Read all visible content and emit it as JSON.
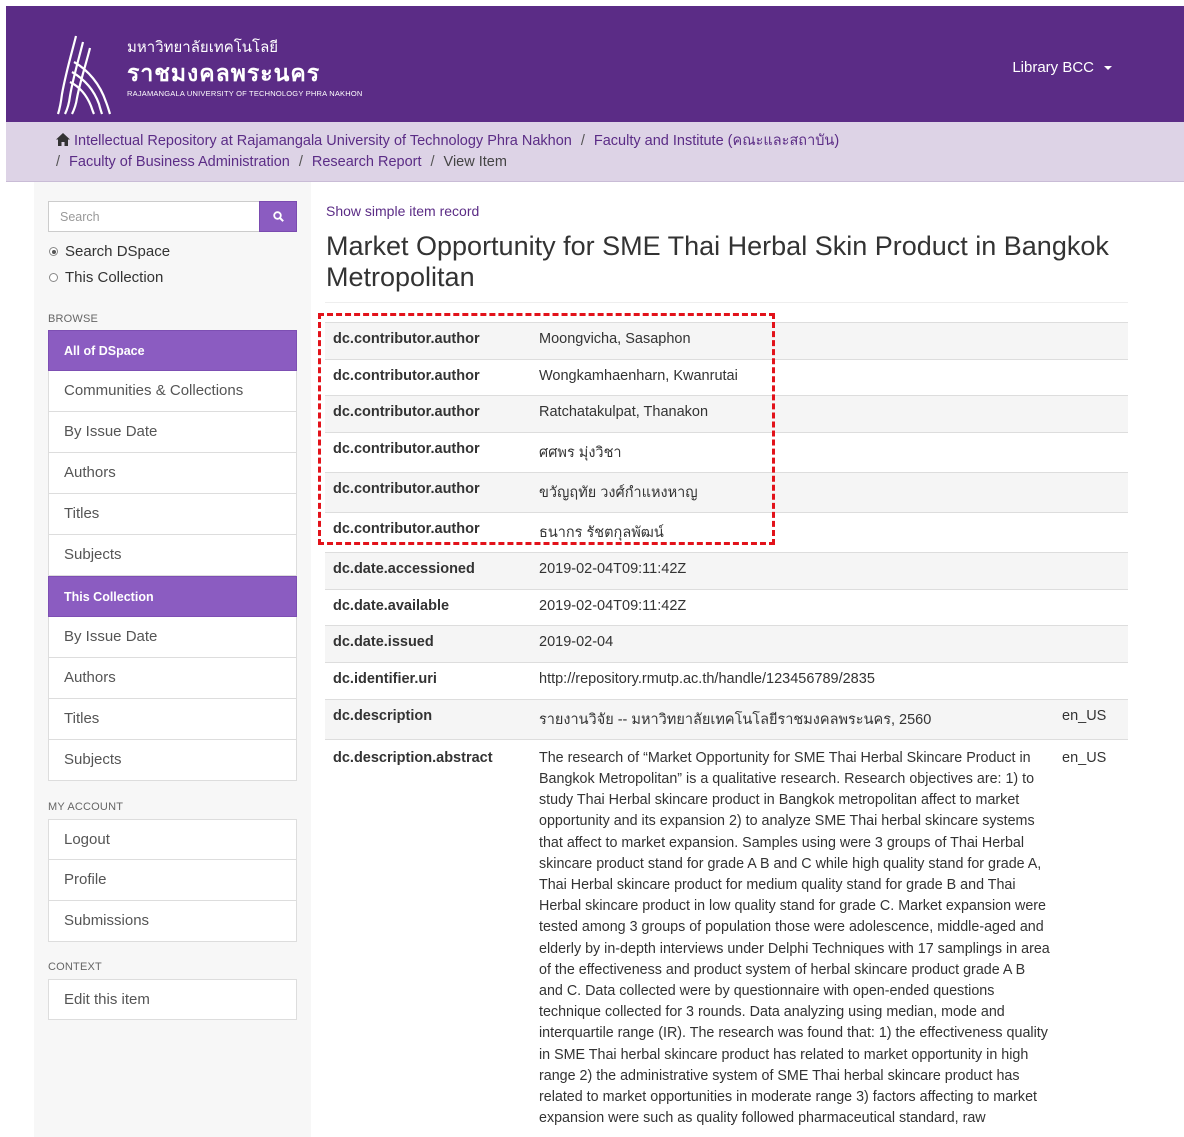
{
  "header": {
    "logo_line1": "มหาวิทยาลัยเทคโนโลยี",
    "logo_line2": "ราชมงคลพระนคร",
    "logo_line3": "RAJAMANGALA UNIVERSITY OF TECHNOLOGY PHRA NAKHON",
    "user_menu_label": "Library BCC"
  },
  "breadcrumb": {
    "items": [
      "Intellectual Repository at Rajamangala University of Technology Phra Nakhon",
      "Faculty and Institute (คณะและสถาบัน)",
      "Faculty of Business Administration",
      "Research Report"
    ],
    "current": "View Item",
    "separator": "/"
  },
  "sidebar": {
    "search_placeholder": "Search",
    "scope_options": [
      "Search DSpace",
      "This Collection"
    ],
    "browse_label": "BROWSE",
    "all_dspace_head": "All of DSpace",
    "all_dspace_items": [
      "Communities & Collections",
      "By Issue Date",
      "Authors",
      "Titles",
      "Subjects"
    ],
    "collection_head": "This Collection",
    "collection_items": [
      "By Issue Date",
      "Authors",
      "Titles",
      "Subjects"
    ],
    "account_label": "MY ACCOUNT",
    "account_items": [
      "Logout",
      "Profile",
      "Submissions"
    ],
    "context_label": "CONTEXT",
    "context_items": [
      "Edit this item"
    ]
  },
  "main": {
    "simple_record_link": "Show simple item record",
    "title": "Market Opportunity for SME Thai Herbal Skin Product in Bangkok Metropolitan",
    "metadata": [
      {
        "field": "dc.contributor.author",
        "value": "Moongvicha, Sasaphon",
        "lang": ""
      },
      {
        "field": "dc.contributor.author",
        "value": "Wongkamhaenharn, Kwanrutai",
        "lang": ""
      },
      {
        "field": "dc.contributor.author",
        "value": "Ratchatakulpat, Thanakon",
        "lang": ""
      },
      {
        "field": "dc.contributor.author",
        "value": "ศศพร มุ่งวิชา",
        "lang": ""
      },
      {
        "field": "dc.contributor.author",
        "value": "ขวัญฤทัย วงศ์กำแหงหาญ",
        "lang": ""
      },
      {
        "field": "dc.contributor.author",
        "value": "ธนากร รัชตกุลพัฒน์",
        "lang": ""
      },
      {
        "field": "dc.date.accessioned",
        "value": "2019-02-04T09:11:42Z",
        "lang": ""
      },
      {
        "field": "dc.date.available",
        "value": "2019-02-04T09:11:42Z",
        "lang": ""
      },
      {
        "field": "dc.date.issued",
        "value": "2019-02-04",
        "lang": ""
      },
      {
        "field": "dc.identifier.uri",
        "value": "http://repository.rmutp.ac.th/handle/123456789/2835",
        "lang": ""
      },
      {
        "field": "dc.description",
        "value": "รายงานวิจัย -- มหาวิทยาลัยเทคโนโลยีราชมงคลพระนคร, 2560",
        "lang": "en_US"
      },
      {
        "field": "dc.description.abstract",
        "value": "The research of “Market Opportunity for SME Thai Herbal Skincare Product in Bangkok Metropolitan” is a qualitative research. Research objectives are: 1) to study Thai Herbal skincare product in Bangkok metropolitan affect to market opportunity and its expansion 2) to analyze SME Thai herbal skincare systems that affect to market expansion. Samples using were 3 groups of Thai Herbal skincare product stand for grade A B and C while high quality stand for grade A, Thai Herbal skincare product for medium quality stand for grade B and Thai Herbal skincare product in low quality stand for grade C. Market expansion were tested among 3 groups of population those were adolescence, middle-aged and elderly by in-depth interviews under Delphi Techniques with 17 samplings in area of the effectiveness and product system of herbal skincare product grade A B and C. Data collected were by questionnaire with open-ended questions technique collected for 3 rounds. Data analyzing using median, mode and interquartile range (IR). The research was found that: 1) the effectiveness quality in SME Thai herbal skincare product has related to market opportunity in high range 2) the administrative system of SME Thai herbal skincare product has related to market opportunities in moderate range 3) factors affecting to market expansion were such as quality followed pharmaceutical standard, raw",
        "lang": "en_US"
      }
    ]
  },
  "colors": {
    "header_purple": "#5b2c86",
    "nav_purple": "#8b5cc1",
    "breadcrumb_bg": "#ddd3e6",
    "highlight_red": "#e2121a"
  }
}
